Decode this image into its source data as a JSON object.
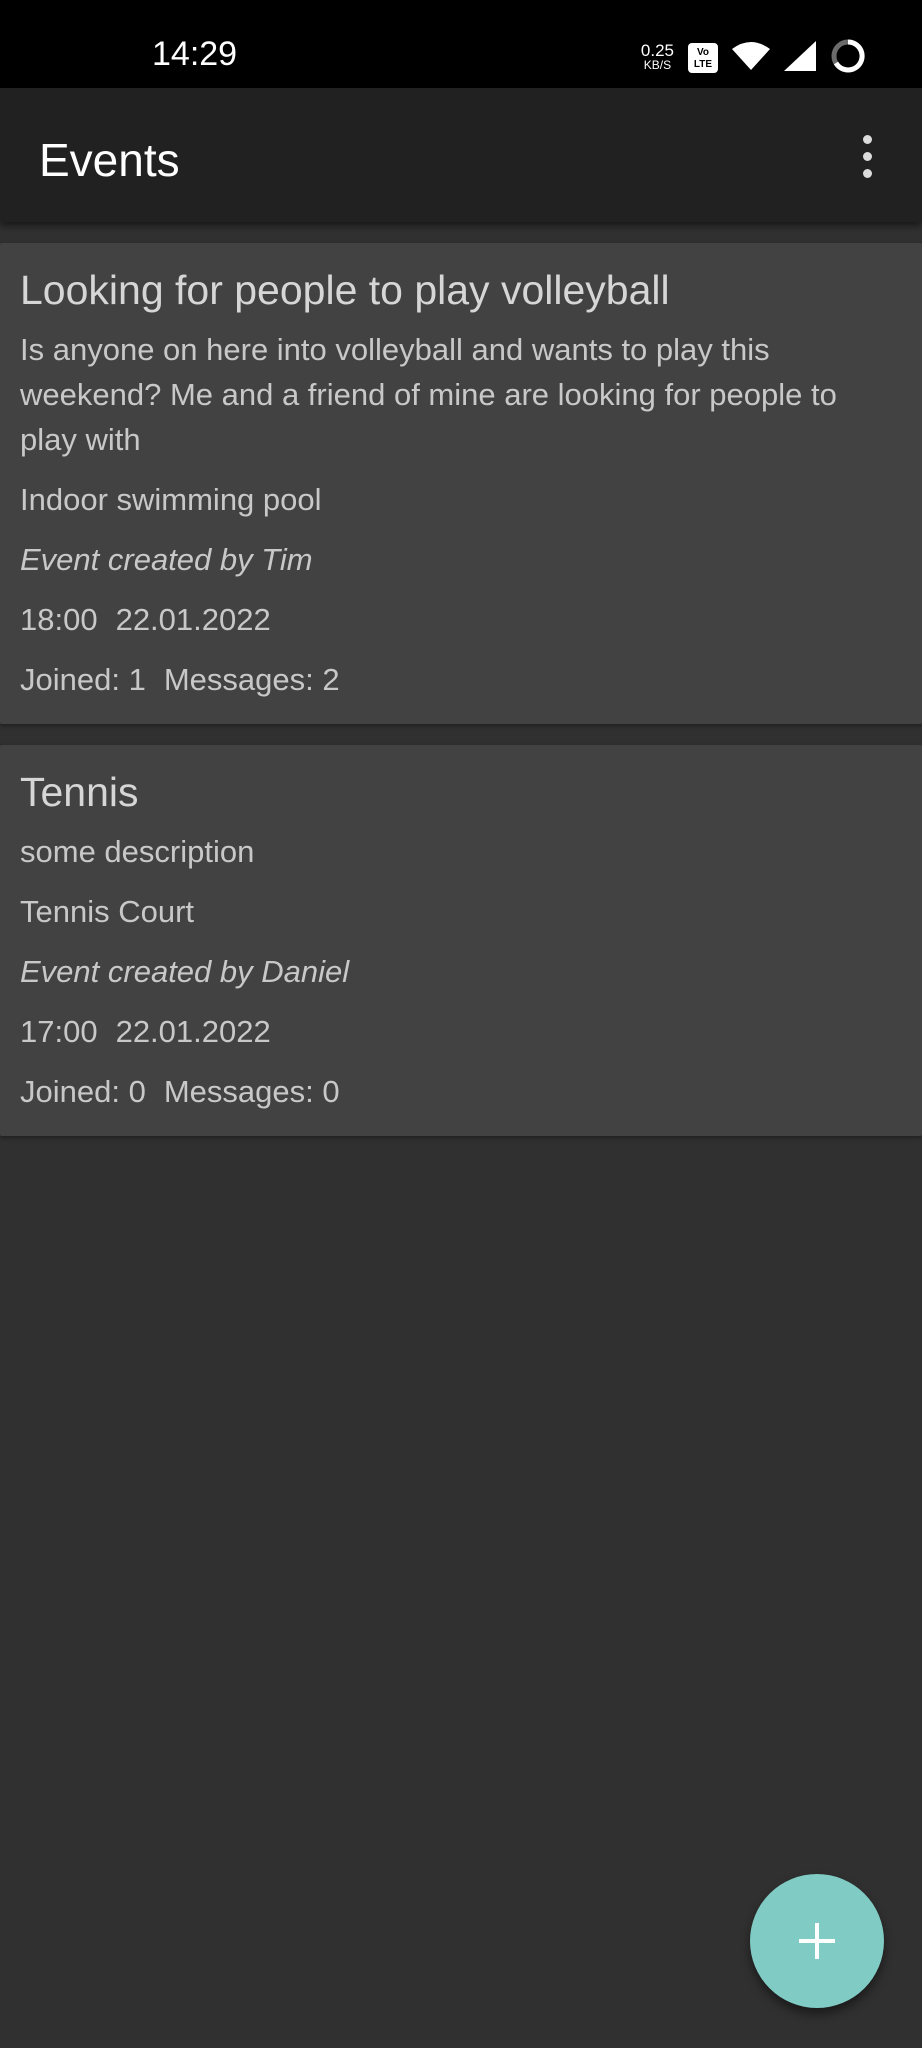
{
  "status_bar": {
    "time": "14:29",
    "net_speed_value": "0.25",
    "net_speed_unit": "KB/S",
    "volte_label": "Vo LTE"
  },
  "app_bar": {
    "title": "Events"
  },
  "events": [
    {
      "title": "Looking for people to play volleyball",
      "description": "Is anyone on here into volleyball and wants to play this weekend? Me and a friend of mine are looking for people to play with",
      "location": "Indoor swimming pool",
      "creator": "Event created by Tim",
      "time": "18:00",
      "date": "22.01.2022",
      "joined": "Joined: 1",
      "messages": "Messages: 2"
    },
    {
      "title": "Tennis",
      "description": "some description",
      "location": "Tennis Court",
      "creator": "Event created by Daniel",
      "time": "17:00",
      "date": "22.01.2022",
      "joined": "Joined: 0",
      "messages": "Messages: 0"
    }
  ],
  "colors": {
    "background": "#303030",
    "app_bar": "#212121",
    "card": "#424242",
    "fab": "#80cbc4"
  }
}
